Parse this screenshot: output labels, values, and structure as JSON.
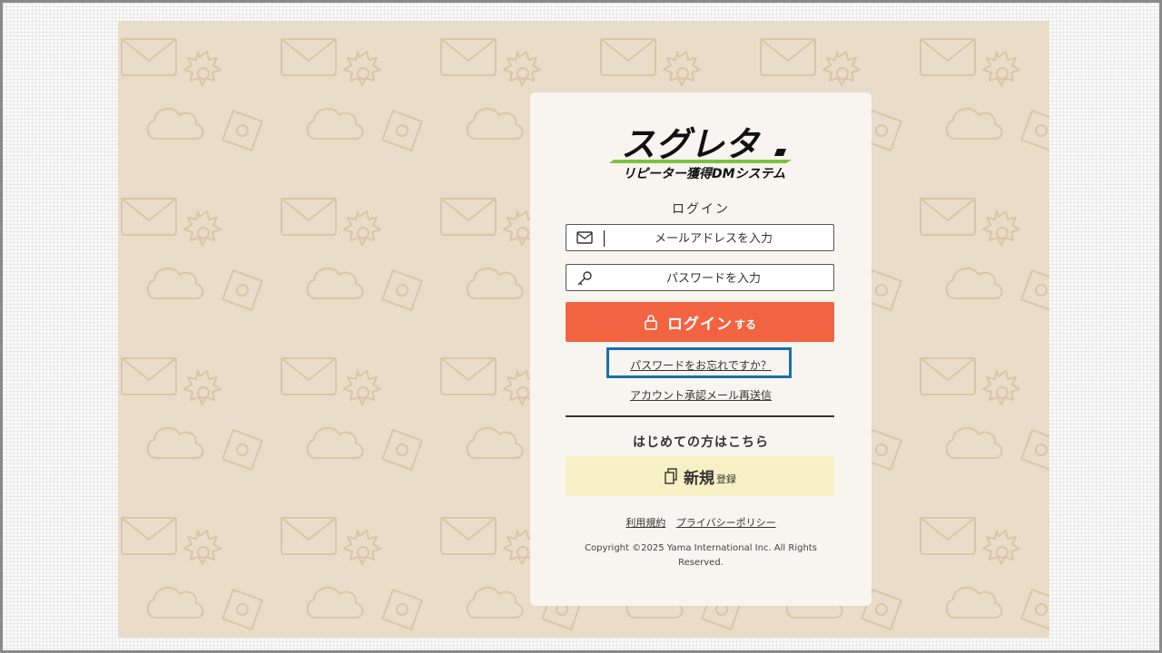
{
  "logo": {
    "title": "スグレタ",
    "tagline": "リピーター獲得DMシステム"
  },
  "login": {
    "heading": "ログイン",
    "email_placeholder": "メールアドレスを入力",
    "password_placeholder": "パスワードを入力",
    "submit_label": "ログイン",
    "submit_suffix": "する",
    "forgot_password": "パスワードをお忘れですか？",
    "resend_confirmation": "アカウント承認メール再送信"
  },
  "register": {
    "heading": "はじめての方はこちら",
    "button_label": "新規",
    "button_suffix": "登録"
  },
  "footer": {
    "terms": "利用規約",
    "privacy": "プライバシーポリシー",
    "copyright": "Copyright ©2025 Yama International Inc. All Rights Reserved."
  },
  "icons": {
    "email": "envelope-icon",
    "password": "key-icon",
    "login": "lock-icon",
    "register": "document-copy-icon"
  },
  "colors": {
    "page_background": "#e9dcc8",
    "card_background": "#f8f5f1",
    "login_button": "#f26341",
    "register_button": "#f7f0c4",
    "logo_accent": "#7cc240",
    "highlight_border": "#1a6fa8"
  }
}
